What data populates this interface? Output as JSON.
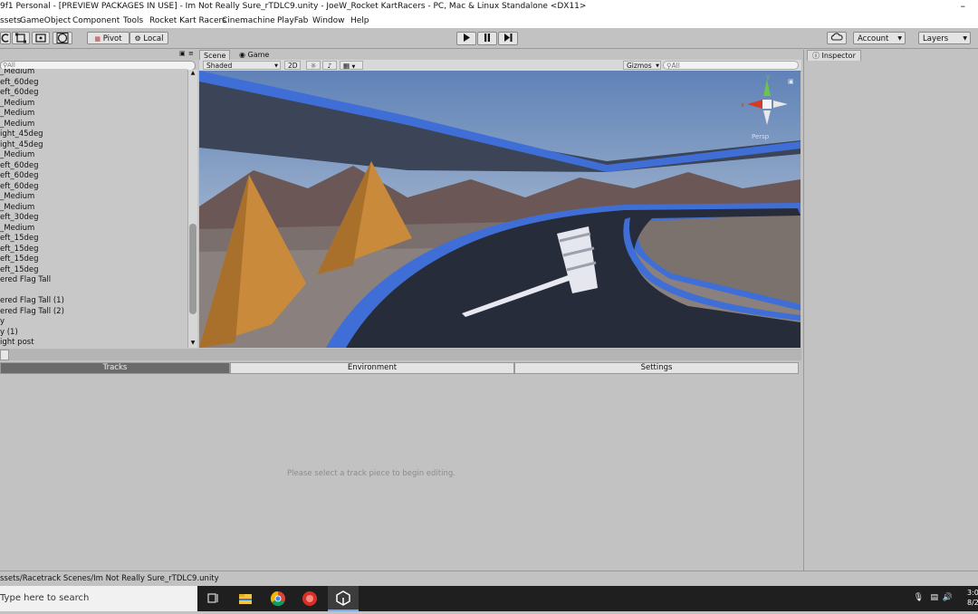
{
  "window": {
    "title": "9f1 Personal - [PREVIEW PACKAGES IN USE] - Im Not Really Sure_rTDLC9.unity - JoeW_Rocket KartRacers - PC, Mac & Linux Standalone <DX11>",
    "minimize_glyph": "–"
  },
  "menu": [
    "ssets",
    "GameObject",
    "Component",
    "Tools",
    "Rocket Kart Racers",
    "Cinemachine",
    "PlayFab",
    "Window",
    "Help"
  ],
  "toolbar": {
    "pivot": "Pivot",
    "local": "Local",
    "account": "Account",
    "layers": "Layers"
  },
  "hierarchy": {
    "search_placeholder": "All",
    "items": [
      "_Medium",
      "eft_60deg",
      "eft_60deg",
      "_Medium",
      "_Medium",
      "_Medium",
      "ight_45deg",
      "ight_45deg",
      "_Medium",
      "eft_60deg",
      "eft_60deg",
      "eft_60deg",
      "_Medium",
      "_Medium",
      "eft_30deg",
      "_Medium",
      "eft_15deg",
      "eft_15deg",
      "eft_15deg",
      "eft_15deg",
      "ered Flag Tall",
      "",
      "ered Flag Tall (1)",
      "ered Flag Tall (2)",
      "y",
      "y (1)",
      "ight post"
    ]
  },
  "scene": {
    "tab_scene": "Scene",
    "tab_game": "Game",
    "shading": "Shaded",
    "mode_2d": "2D",
    "gizmos": "Gizmos",
    "search_placeholder": "All",
    "projection": "Persp",
    "colors": {
      "track_edge": "#3f6fd6",
      "track": "#272c3a",
      "cone": "#c98a3b"
    }
  },
  "panel": {
    "tabs": [
      "Tracks",
      "Environment",
      "Settings"
    ],
    "message": "Please select a track piece to begin editing."
  },
  "inspector": {
    "title": "Inspector"
  },
  "status": {
    "path": "ssets/Racetrack Scenes/Im Not Really Sure_rTDLC9.unity"
  },
  "taskbar": {
    "search": "Type here to search",
    "time": "3:0",
    "date": "8/2"
  }
}
